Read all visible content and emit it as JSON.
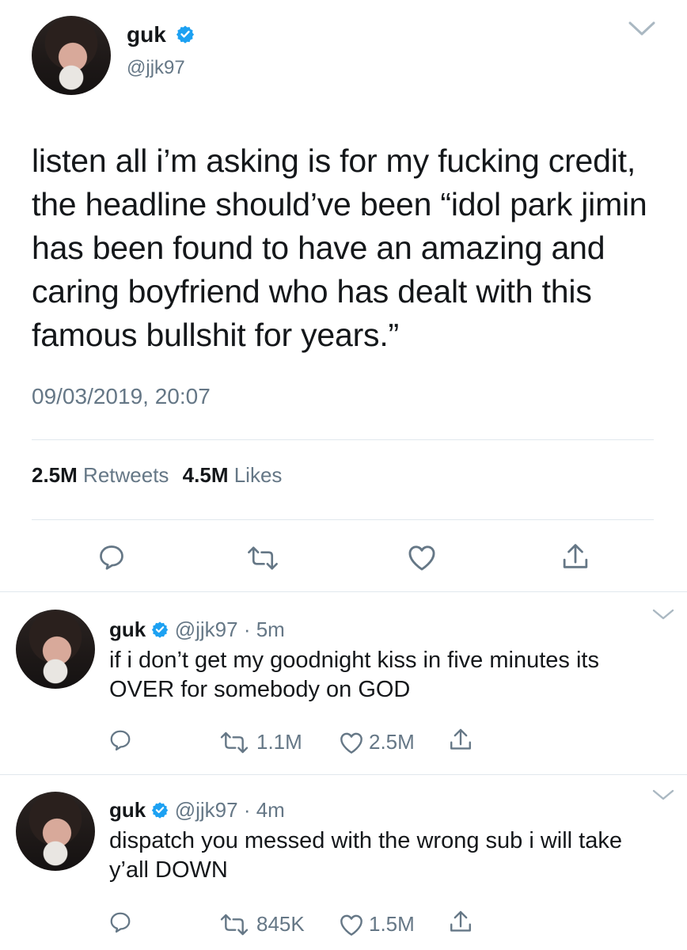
{
  "main_tweet": {
    "display_name": "guk",
    "handle": "@jjk97",
    "text": "listen all i’m asking is for my fucking credit, the headline should’ve been “idol park jimin has been found to have an amazing and caring boyfriend who has dealt with this famous bullshit for years.”",
    "timestamp": "09/03/2019, 20:07",
    "retweets_count": "2.5M",
    "retweets_label": "Retweets",
    "likes_count": "4.5M",
    "likes_label": "Likes"
  },
  "replies": [
    {
      "display_name": "guk",
      "handle": "@jjk97",
      "time": "· 5m",
      "text": "if i don’t get my goodnight kiss in five minutes its OVER for somebody on GOD",
      "retweets": "1.1M",
      "likes": "2.5M"
    },
    {
      "display_name": "guk",
      "handle": "@jjk97",
      "time": "· 4m",
      "text": "dispatch you messed with the wrong sub i will take y’all DOWN",
      "retweets": "845K",
      "likes": "1.5M"
    }
  ],
  "colors": {
    "verified": "#1da1f2",
    "text": "#14171a",
    "muted": "#657786",
    "divider": "#e1e8ed"
  },
  "icons": [
    "avatar",
    "verified-badge-icon",
    "chevron-down-icon",
    "reply-icon",
    "retweet-icon",
    "like-icon",
    "share-icon"
  ]
}
